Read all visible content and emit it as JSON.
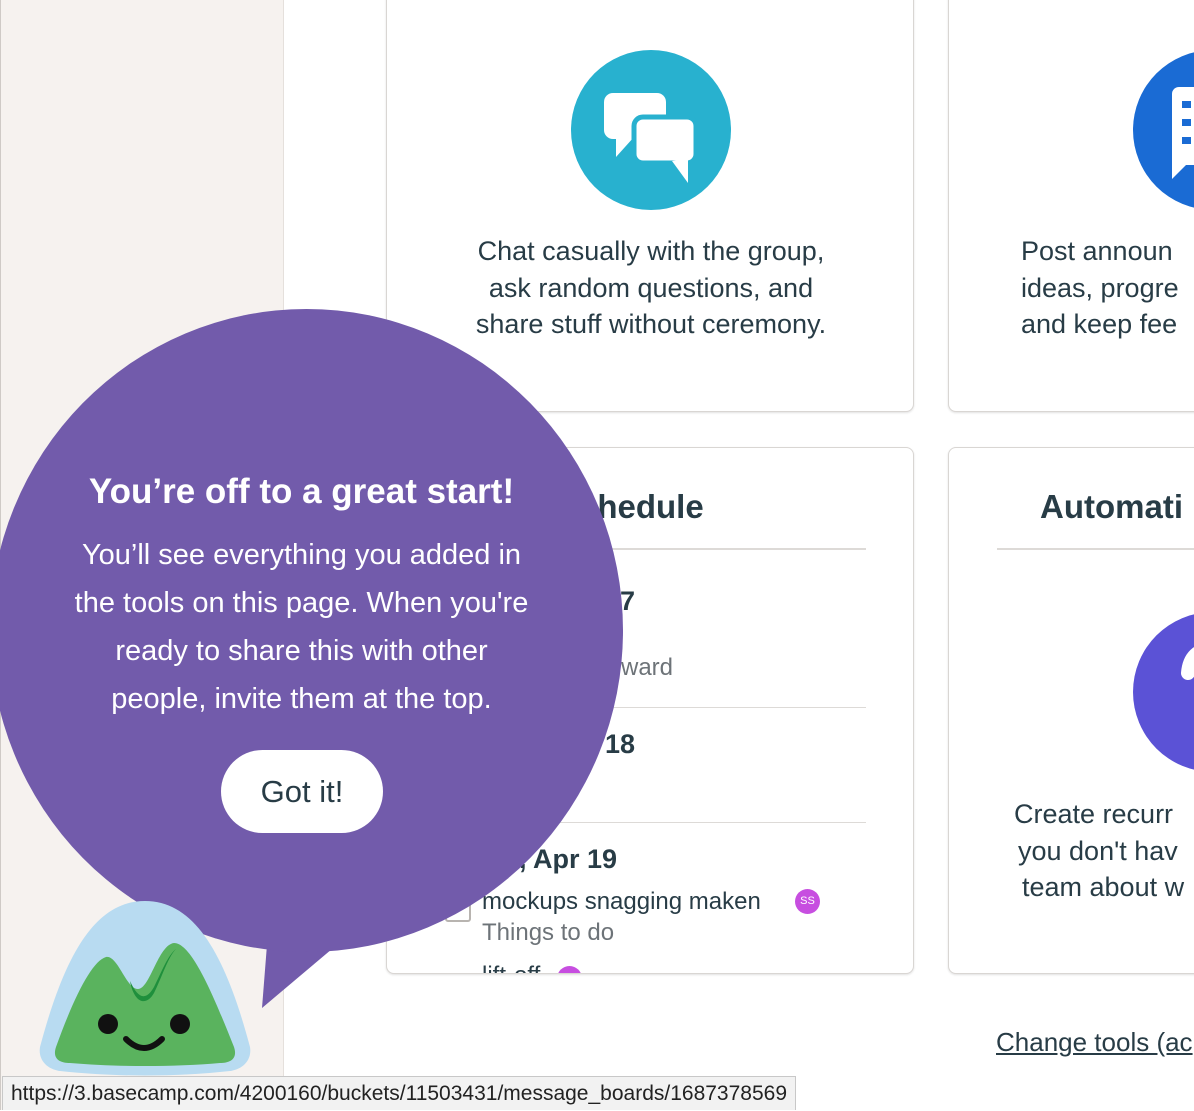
{
  "cards": {
    "campfire": {
      "description_lines": [
        "Chat casually with the group,",
        "ask random questions, and",
        "share stuff without ceremony."
      ],
      "icon": "chat-bubbles-icon",
      "icon_color": "#28b1cf"
    },
    "message_board": {
      "description_lines": [
        "Post announ",
        "ideas, progre",
        "and keep fee"
      ],
      "icon": "message-board-icon",
      "icon_color": "#1a6bd4"
    },
    "schedule": {
      "heading": "chedule",
      "day1_partial": "17",
      "event1_partial": "ward",
      "day2_partial": "18",
      "day3": ", Apr 19",
      "event3_title": "mockups snagging maken",
      "event3_avatar": "SS",
      "event3_list": "Things to do",
      "event4_partial": "lift-off",
      "avatar_color": "#c74ee0"
    },
    "automatic": {
      "heading": "Automati",
      "description_lines": [
        "Create recurr",
        "you don't hav",
        "team about w"
      ],
      "icon": "question-icon",
      "icon_color": "#5b52d6"
    }
  },
  "change_tools_link": "Change tools (ac",
  "tour": {
    "title": "You’re off to a great start!",
    "body_lines": [
      "You’ll see everything you added in",
      "the tools on this page. When you're",
      "ready to share this with other",
      "people, invite them at the top."
    ],
    "button_label": "Got it!",
    "bubble_color": "#725bab"
  },
  "status_bar_url": "https://3.basecamp.com/4200160/buckets/11503431/message_boards/1687378569"
}
